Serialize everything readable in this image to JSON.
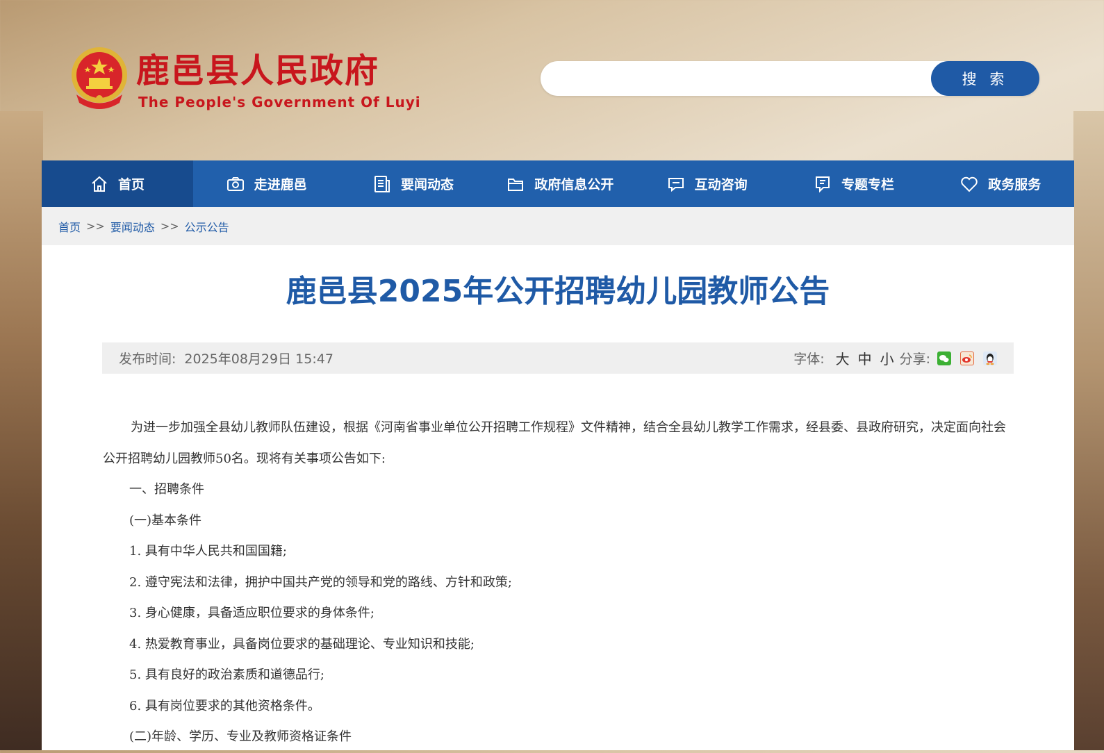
{
  "header": {
    "title": "鹿邑县人民政府",
    "subtitle": "The People's Government Of Luyi",
    "emblem_icon": "national-emblem-icon",
    "search": {
      "placeholder": "",
      "button_label": "搜 索"
    }
  },
  "nav": {
    "items": [
      {
        "label": "首页",
        "icon": "home-icon",
        "active": true
      },
      {
        "label": "走进鹿邑",
        "icon": "camera-icon"
      },
      {
        "label": "要闻动态",
        "icon": "document-icon"
      },
      {
        "label": "政府信息公开",
        "icon": "folder-icon"
      },
      {
        "label": "互动咨询",
        "icon": "chat-icon"
      },
      {
        "label": "专题专栏",
        "icon": "bookmark-icon"
      },
      {
        "label": "政务服务",
        "icon": "heart-icon"
      }
    ]
  },
  "breadcrumb": {
    "items": [
      "首页",
      "要闻动态",
      "公示公告"
    ],
    "separator": ">>"
  },
  "article": {
    "title": "鹿邑县2025年公开招聘幼儿园教师公告",
    "publish_label": "发布时间:",
    "publish_date": "2025年08月29日 15:47",
    "font_label": "字体:",
    "font_sizes": [
      "大",
      "中",
      "小"
    ],
    "share_label": "分享:",
    "share_icons": [
      "wechat-icon",
      "weibo-icon",
      "qq-icon"
    ],
    "paragraphs": [
      "为进一步加强全县幼儿教师队伍建设，根据《河南省事业单位公开招聘工作规程》文件精神，结合全县幼儿教学工作需求，经县委、县政府研究，决定面向社会公开招聘幼儿园教师50名。现将有关事项公告如下:",
      "一、招聘条件",
      "(一)基本条件",
      "1. 具有中华人民共和国国籍;",
      "2. 遵守宪法和法律，拥护中国共产党的领导和党的路线、方针和政策;",
      "3. 身心健康，具备适应职位要求的身体条件;",
      "4. 热爱教育事业，具备岗位要求的基础理论、专业知识和技能;",
      "5. 具有良好的政治素质和道德品行;",
      "6. 具有岗位要求的其他资格条件。",
      "(二)年龄、学历、专业及教师资格证条件"
    ]
  },
  "colors": {
    "brand_red": "#c8161d",
    "nav_blue": "#2160ac",
    "nav_active": "#174b8e",
    "title_blue": "#1f5aa6"
  }
}
